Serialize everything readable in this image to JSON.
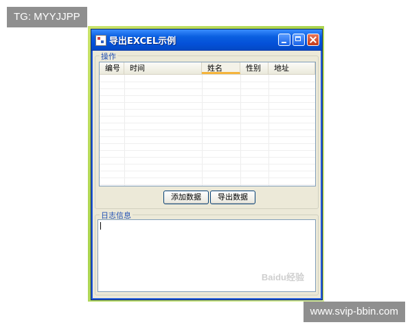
{
  "overlays": {
    "top_left_tag": "TG: MYYJJPP",
    "bottom_right_tag": "www.svip-bbin.com"
  },
  "window": {
    "title": "导出EXCEL示例",
    "icon": "app-window-icon",
    "controls": [
      "minimize-icon",
      "maximize-icon",
      "close-icon"
    ]
  },
  "operations_group": {
    "label": "操作",
    "grid": {
      "columns": [
        "编号",
        "时间",
        "姓名",
        "性别",
        "地址"
      ],
      "rows": []
    },
    "buttons": {
      "add_label": "添加数据",
      "export_label": "导出数据"
    }
  },
  "log_group": {
    "label": "日志信息",
    "text": ""
  },
  "watermark": "Baidu经验",
  "colors": {
    "titlebar": "#0450d8",
    "window_bg": "#ece9d8",
    "group_label": "#1f4fb3",
    "sorted_column_accent": "#f5b43a"
  }
}
